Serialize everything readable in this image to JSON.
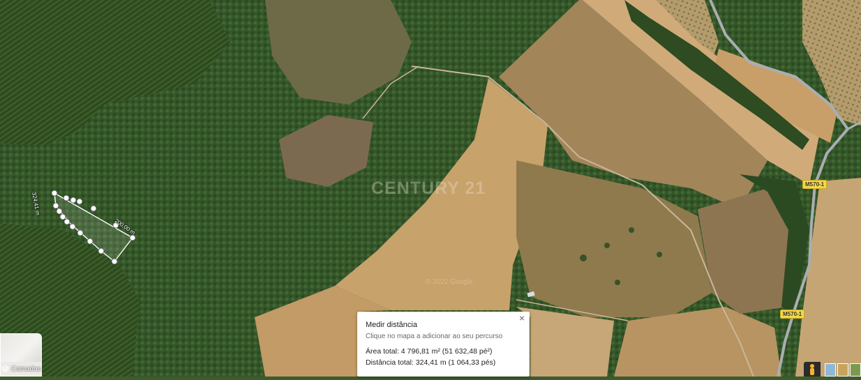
{
  "watermark": "CENTURY 21",
  "map_copyright": "© 2022 Google",
  "road_labels": [
    "M570-1",
    "M570-1"
  ],
  "measurement_labels": {
    "segment_1": "324,41 m",
    "segment_2": "200,00 m"
  },
  "layers_button": {
    "label": "Camadas",
    "icon": "layers-icon"
  },
  "measure_panel": {
    "title": "Medir distância",
    "hint": "Clique no mapa a adicionar ao seu percurso",
    "area": "Área total: 4 796,81 m² (51 632,48 pé²)",
    "distance": "Distância total: 324,41 m (1 064,33 pés)",
    "close_icon": "close-icon"
  },
  "bottom_controls": {
    "pegman_icon": "pegman-icon",
    "imagery_thumbnails": [
      "terrain",
      "satellite",
      "map"
    ]
  },
  "colors": {
    "forest_dark": "#2f4a22",
    "forest_mid": "#3d5d2a",
    "field_tan": "#b08c5c",
    "field_light": "#c9a572",
    "road": "#9aa0a4",
    "road_label": "#f5d84a"
  }
}
